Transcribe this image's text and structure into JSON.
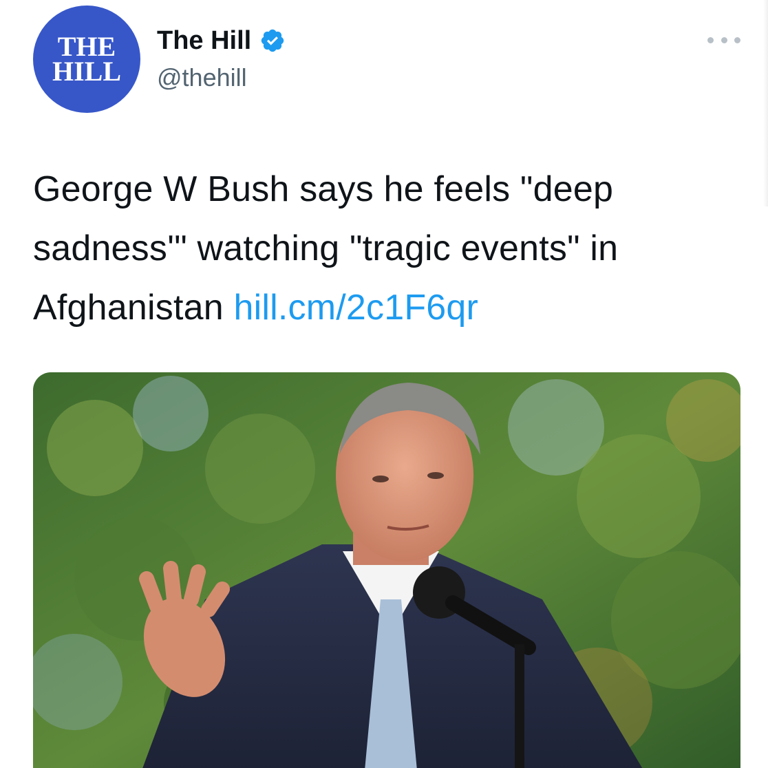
{
  "tweet": {
    "author": {
      "display_name": "The Hill",
      "handle": "@thehill",
      "verified": true,
      "avatar_logo_lines": [
        "THE",
        "HILL"
      ],
      "avatar_color": "#3757c9"
    },
    "text": {
      "line1": "George W Bush says he feels \"deep",
      "line2": "sadness'\" watching \"tragic events\" in",
      "line3_prefix": "Afghanistan ",
      "link": "hill.cm/2c1F6qr"
    },
    "link_color": "#1d9bf0",
    "more_icon": "ellipsis-icon",
    "verified_icon": "verified-badge-icon"
  }
}
